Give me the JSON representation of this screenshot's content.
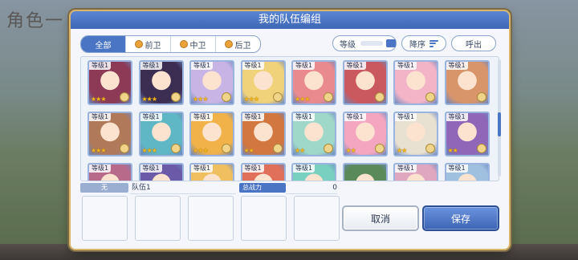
{
  "background": {
    "title": "角色一"
  },
  "dialog": {
    "title": "我的队伍编组",
    "filter_tabs": [
      {
        "label": "全部",
        "active": true
      },
      {
        "label": "前卫",
        "active": false
      },
      {
        "label": "中卫",
        "active": false
      },
      {
        "label": "后卫",
        "active": false
      }
    ],
    "level_label": "等级",
    "sort_label": "降序",
    "call_label": "呼出"
  },
  "characters": [
    {
      "level": "等级1",
      "stars": "★★★",
      "color": "#8c3a56"
    },
    {
      "level": "等级1",
      "stars": "★★★",
      "color": "#3c2d52"
    },
    {
      "level": "等级1",
      "stars": "★★★",
      "color": "#c9b4e6"
    },
    {
      "level": "等级1",
      "stars": "★★★",
      "color": "#f0d27a"
    },
    {
      "level": "等级1",
      "stars": "★★★",
      "color": "#e98a8e"
    },
    {
      "level": "等级1",
      "stars": "",
      "color": "#c9595e"
    },
    {
      "level": "等级1",
      "stars": "",
      "color": "#f3b4c8"
    },
    {
      "level": "等级1",
      "stars": "",
      "color": "#d9956a"
    },
    {
      "level": "等级1",
      "stars": "★★★",
      "color": "#b07a5a"
    },
    {
      "level": "等级1",
      "stars": "★★★",
      "color": "#5fb6c4"
    },
    {
      "level": "等级1",
      "stars": "★★★",
      "color": "#f1b24a"
    },
    {
      "level": "等级1",
      "stars": "★★",
      "color": "#d2773f"
    },
    {
      "level": "等级1",
      "stars": "★★",
      "color": "#9fd8c9"
    },
    {
      "level": "等级1",
      "stars": "★★",
      "color": "#f4a6c0"
    },
    {
      "level": "等级1",
      "stars": "★★",
      "color": "#e8e0d0"
    },
    {
      "level": "等级1",
      "stars": "★★",
      "color": "#8f66b8"
    },
    {
      "level": "等级1",
      "stars": "",
      "color": "#b86a8a"
    },
    {
      "level": "等级1",
      "stars": "",
      "color": "#6a5aa8"
    },
    {
      "level": "等级1",
      "stars": "",
      "color": "#f0c060"
    },
    {
      "level": "等级1",
      "stars": "",
      "color": "#e0705a"
    },
    {
      "level": "等级1",
      "stars": "",
      "color": "#7ad0c0"
    },
    {
      "level": "",
      "stars": "",
      "color": "#5a8a5a"
    },
    {
      "level": "等级1",
      "stars": "",
      "color": "#e0a8c0"
    },
    {
      "level": "等级1",
      "stars": "",
      "color": "#a0c0e0"
    }
  ],
  "team": {
    "label": "无",
    "name": "队伍1",
    "power_label": "总战力",
    "power_value": "0",
    "slots": 5
  },
  "buttons": {
    "cancel": "取消",
    "save": "保存"
  }
}
